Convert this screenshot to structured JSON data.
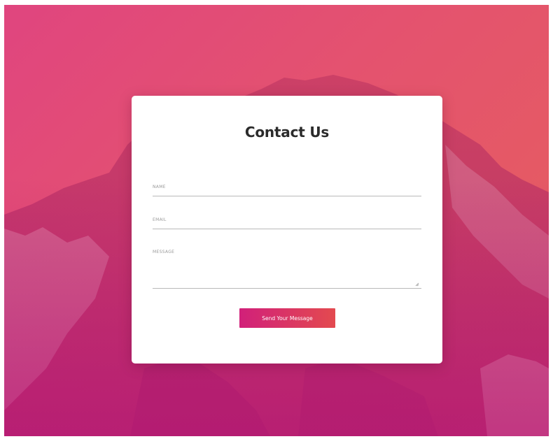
{
  "form": {
    "title": "Contact Us",
    "name_label": "Name",
    "name_value": "",
    "email_label": "Email",
    "email_value": "",
    "message_label": "Message",
    "message_value": "",
    "submit_label": "Send Your Message"
  },
  "colors": {
    "gradient_start": "#e0457f",
    "gradient_end": "#e6605b",
    "button_start": "#d1207a",
    "button_end": "#e34a4f",
    "card_background": "#ffffff",
    "title_text": "#2b2b2b"
  },
  "icons": {
    "textarea_resize": "resize-grip-icon"
  }
}
